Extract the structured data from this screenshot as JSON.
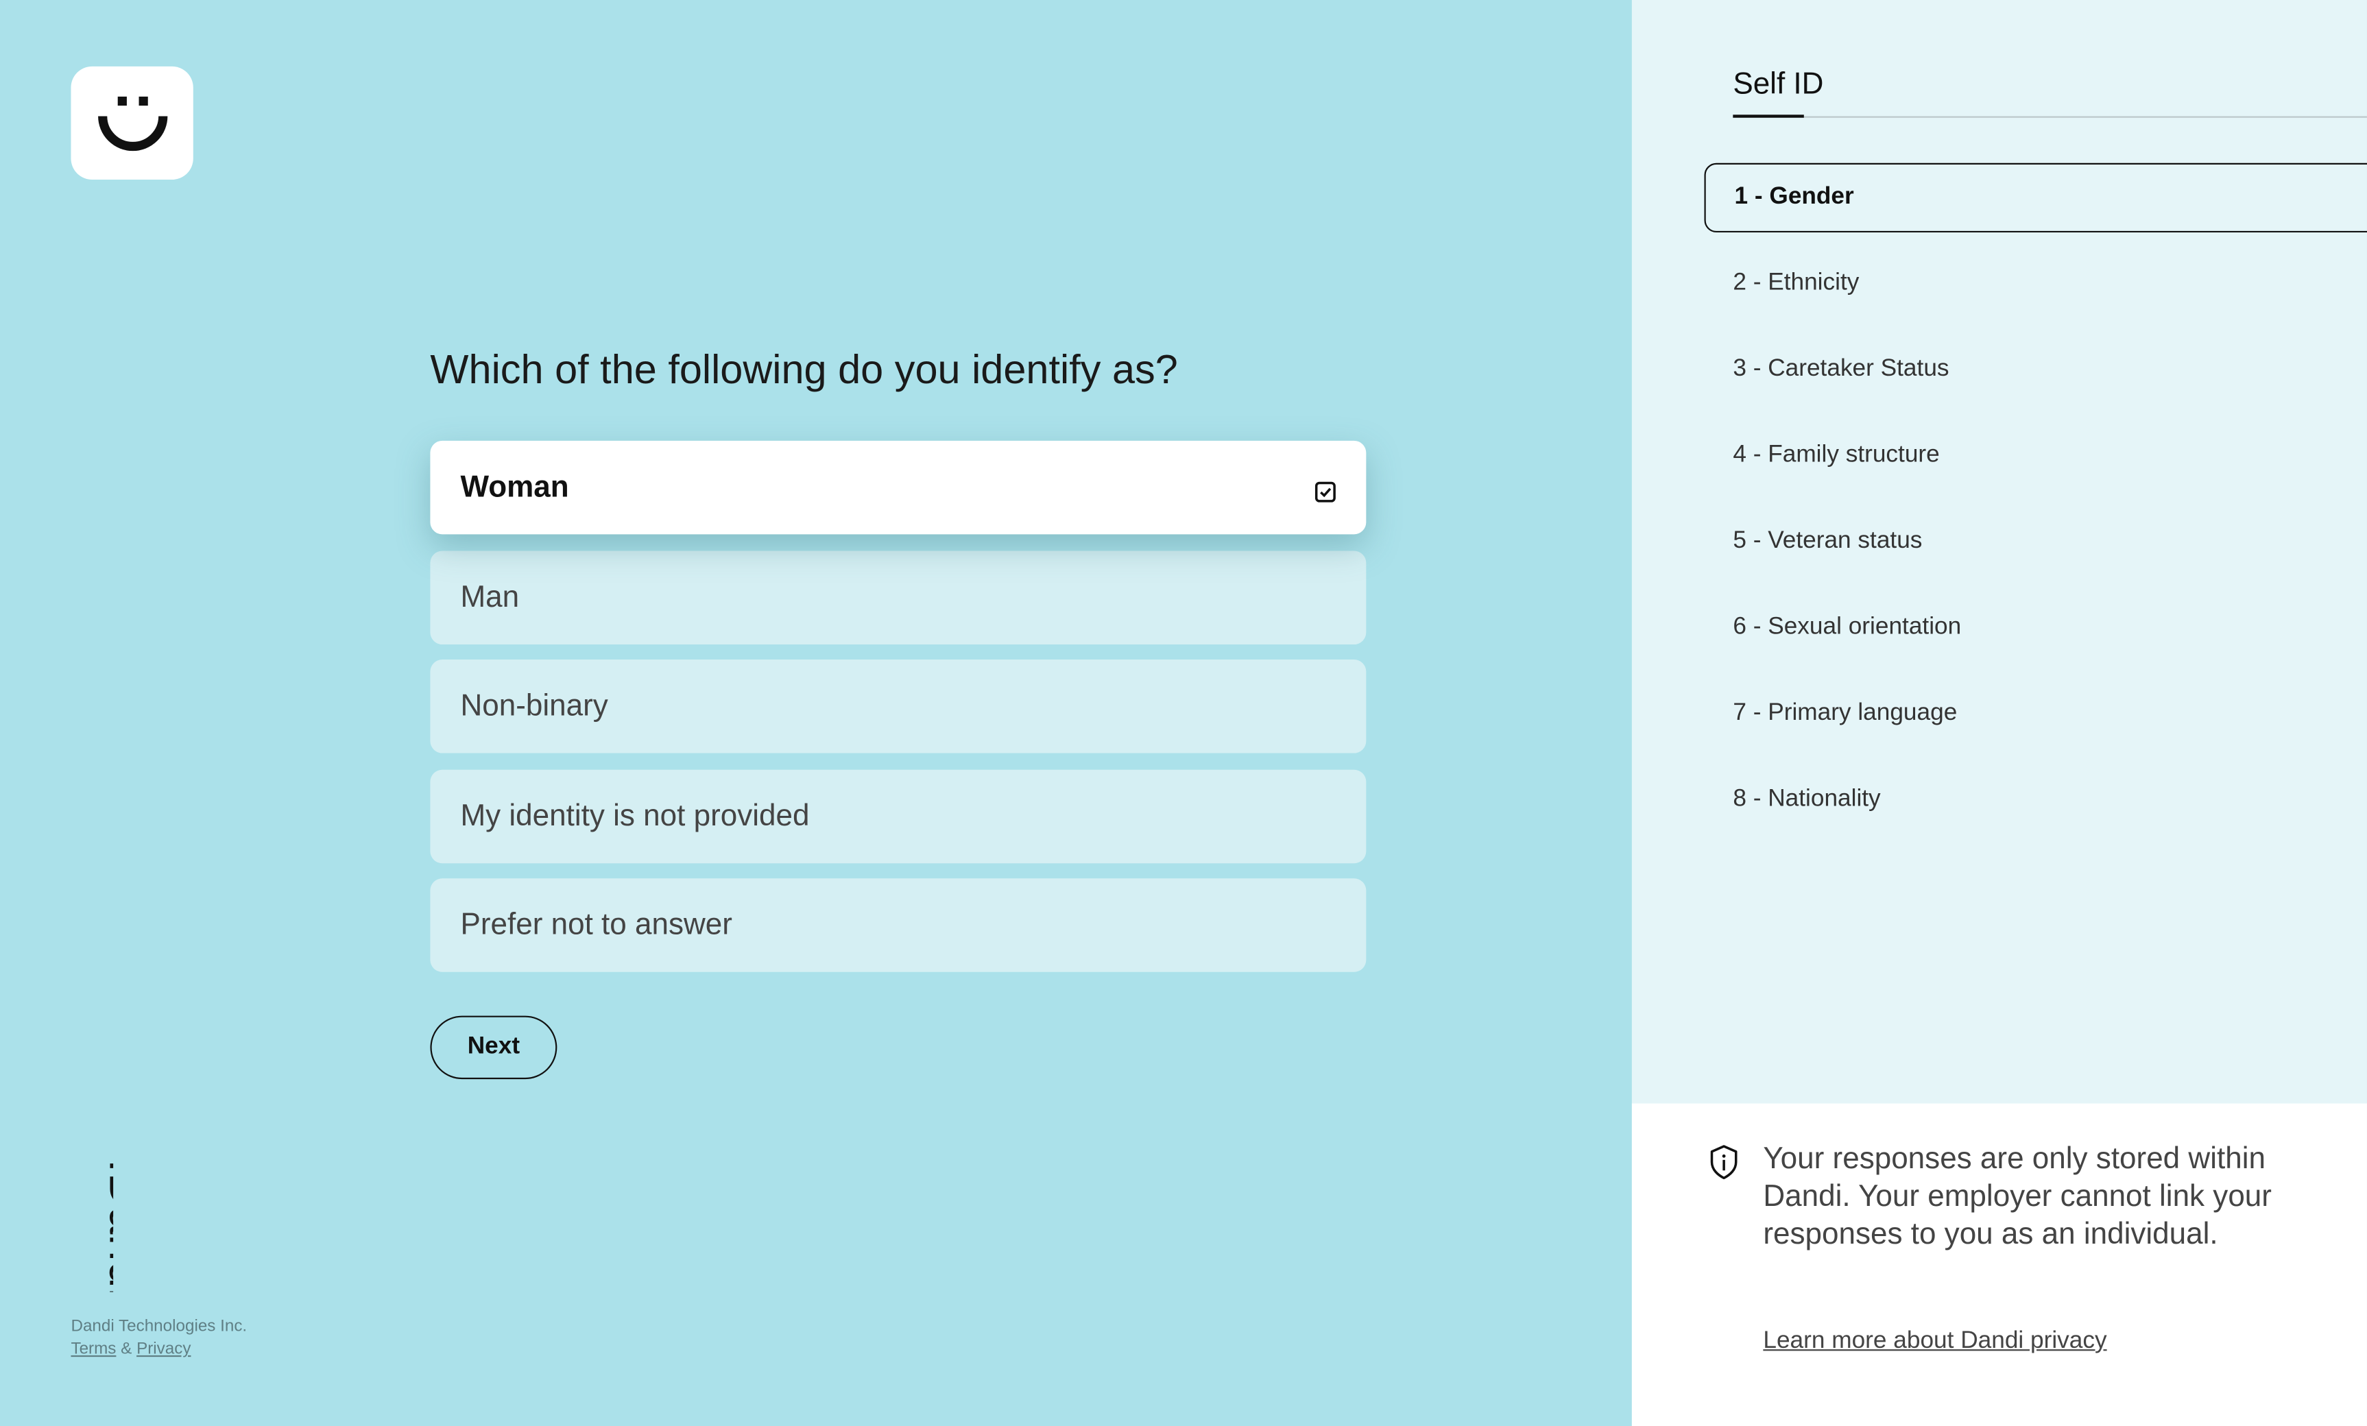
{
  "brand": {
    "name": "Dandi",
    "company": "Dandi Technologies Inc.",
    "terms": "Terms",
    "amp": "&",
    "privacy": "Privacy",
    "icon": "smiley-logo-icon"
  },
  "question": "Which of the following do you identify as?",
  "options": [
    {
      "label": "Woman",
      "selected": true
    },
    {
      "label": "Man",
      "selected": false
    },
    {
      "label": "Non-binary",
      "selected": false
    },
    {
      "label": "My identity is not provided",
      "selected": false
    },
    {
      "label": "Prefer not to answer",
      "selected": false
    }
  ],
  "next_label": "Next",
  "sidebar": {
    "tab": "Self ID",
    "steps": [
      {
        "label": "1 - Gender",
        "active": true
      },
      {
        "label": "2 - Ethnicity"
      },
      {
        "label": "3 - Caretaker Status"
      },
      {
        "label": "4 - Family structure"
      },
      {
        "label": "5 - Veteran status"
      },
      {
        "label": "6 - Sexual orientation"
      },
      {
        "label": "7 - Primary language"
      },
      {
        "label": "8 - Nationality"
      }
    ]
  },
  "notice": {
    "text": "Your responses are only stored within Dandi. Your employer cannot link your responses to you as an individual.",
    "link": "Learn more about Dandi privacy",
    "icon": "shield-info-icon"
  },
  "colors": {
    "left_bg": "#abe1ea",
    "option_bg": "#d5eff3",
    "right_bg": "#e5f5f8",
    "text": "#111111"
  }
}
